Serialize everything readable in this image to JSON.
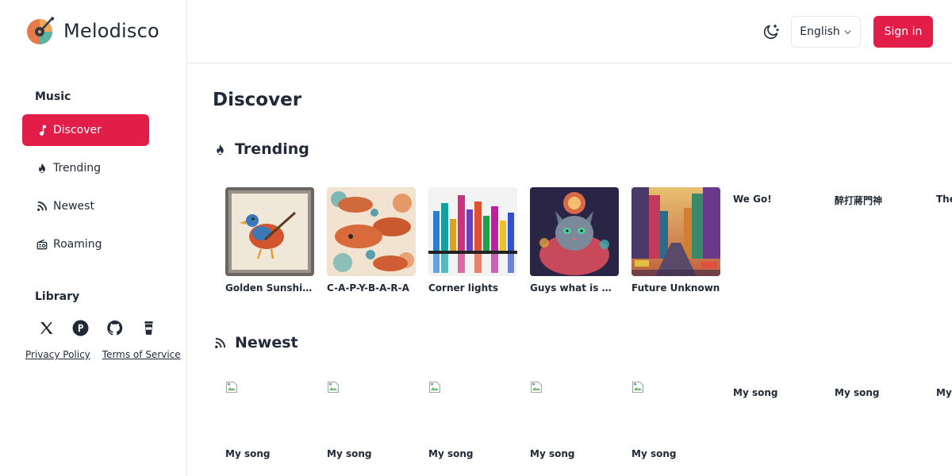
{
  "app": {
    "name": "Melodisco"
  },
  "sidebar": {
    "music_title": "Music",
    "items": [
      {
        "label": "Discover",
        "icon": "music-note-icon",
        "active": true
      },
      {
        "label": "Trending",
        "icon": "flame-icon"
      },
      {
        "label": "Newest",
        "icon": "rss-icon"
      },
      {
        "label": "Roaming",
        "icon": "radio-icon"
      }
    ],
    "library_title": "Library",
    "social": [
      "x-icon",
      "producthunt-icon",
      "github-icon",
      "coffee-cup-icon"
    ],
    "footer": {
      "privacy": "Privacy Policy",
      "terms": "Terms of Service"
    }
  },
  "header": {
    "language": "English",
    "signin": "Sign in",
    "theme_icon": "moon-stars-icon"
  },
  "main": {
    "page_title": "Discover",
    "trending": {
      "title": "Trending",
      "songs": [
        "Golden Sunshine Groove",
        "C-A-P-Y-B-A-R-A",
        "Corner lights",
        "Guys what is wrong with me",
        "Future Unknown",
        "We Go!",
        "醉打蔣門神",
        "The"
      ]
    },
    "newest": {
      "title": "Newest",
      "songs": [
        "My song",
        "My song",
        "My song",
        "My song",
        "My song",
        "My song",
        "My song",
        "My"
      ]
    }
  },
  "colors": {
    "accent": "#e11d48",
    "text": "#1f2937",
    "border": "#e5e7eb"
  }
}
